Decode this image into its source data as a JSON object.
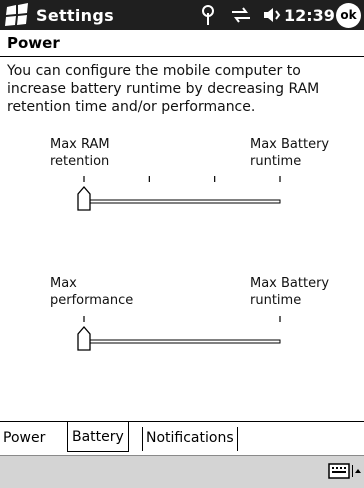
{
  "titlebar": {
    "title": "Settings",
    "time": "12:39",
    "ok_label": "ok"
  },
  "page": {
    "title": "Power",
    "description": "You can configure the mobile computer to increase battery runtime by decreasing RAM retention time and/or performance."
  },
  "sliders": {
    "ram": {
      "left_label": "Max RAM\nretention",
      "right_label": "Max Battery\nruntime",
      "value": 0,
      "ticks": 4
    },
    "performance": {
      "left_label": "Max\nperformance",
      "right_label": "Max Battery\nruntime",
      "value": 0,
      "ticks": 2
    }
  },
  "tabs": [
    {
      "label": "Power",
      "selected": false
    },
    {
      "label": "Battery",
      "selected": true
    },
    {
      "label": "Notifications",
      "selected": false
    }
  ],
  "icons": {
    "start": "windows-flag-icon",
    "antenna": "antenna-icon",
    "sync": "sync-arrows-icon",
    "speaker": "speaker-icon",
    "keyboard": "keyboard-icon",
    "input_arrow": "up-arrow-icon"
  },
  "colors": {
    "titlebar_bg": "#1f1f1f",
    "bottom_bar_bg": "#d4d4d4"
  }
}
